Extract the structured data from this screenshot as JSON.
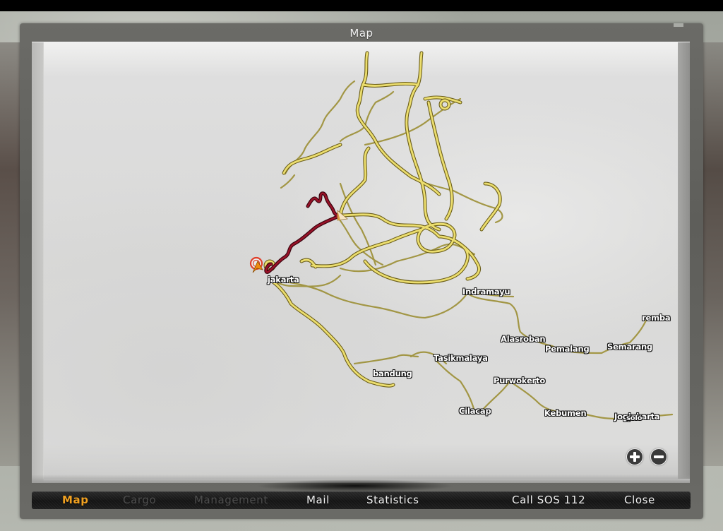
{
  "window": {
    "title": "Map"
  },
  "map": {
    "colors": {
      "major_road": "#e8d96a",
      "major_road_outline": "#6b5e1a",
      "minor_road": "#b7a94a",
      "route": "#8a0f22",
      "background": "#dcdcdb",
      "player_marker": "#f08c10",
      "destination_ring": "#e0402a"
    },
    "icons": {
      "player_position": "orange-arrow-icon",
      "destination": "red-ring-target-icon",
      "truck_position": "cream-arrow-icon"
    },
    "cities": [
      {
        "name": "jakarta"
      },
      {
        "name": "Indramayu"
      },
      {
        "name": "remba"
      },
      {
        "name": "Alasroban"
      },
      {
        "name": "Pemalang"
      },
      {
        "name": "Semarang"
      },
      {
        "name": "Tasikmalaya"
      },
      {
        "name": "bandung"
      },
      {
        "name": "Purwokerto"
      },
      {
        "name": "Cilacap"
      },
      {
        "name": "Kebumen"
      },
      {
        "name": "Jogjakarta"
      },
      {
        "name": "solo"
      }
    ],
    "zoom_controls": {
      "zoom_in": "+",
      "zoom_out": "−"
    }
  },
  "menu": {
    "items": [
      {
        "label": "Map",
        "state": "active"
      },
      {
        "label": "Cargo",
        "state": "disabled"
      },
      {
        "label": "Management",
        "state": "disabled"
      },
      {
        "label": "Mail",
        "state": "enabled"
      },
      {
        "label": "Statistics",
        "state": "enabled"
      },
      {
        "label": "Call SOS 112",
        "state": "enabled"
      },
      {
        "label": "Close",
        "state": "enabled"
      }
    ]
  }
}
